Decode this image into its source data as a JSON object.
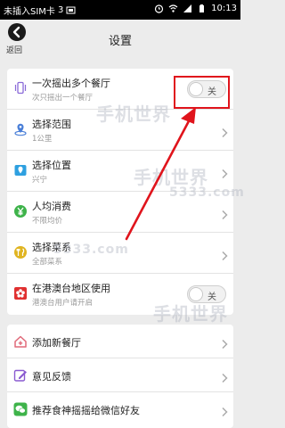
{
  "status_bar": {
    "carrier": "未插入SIM卡",
    "carrier2": "3",
    "time": "10:13"
  },
  "header": {
    "back_label": "返回",
    "title": "设置"
  },
  "settings_group_1": [
    {
      "id": "shake-multiple",
      "title": "一次摇出多个餐厅",
      "subtitle": "次只摇出一个餐厅",
      "control": "toggle",
      "toggle_label": "关",
      "icon": "phone-shake-icon",
      "icon_color": "#8a6ad8"
    },
    {
      "id": "select-range",
      "title": "选择范围",
      "subtitle": "1公里",
      "control": "chevron",
      "icon": "location-range-icon",
      "icon_color": "#4a7fd8"
    },
    {
      "id": "select-location",
      "title": "选择位置",
      "subtitle": "兴宁",
      "control": "chevron",
      "icon": "map-pin-icon",
      "icon_color": "#2ea0e0"
    },
    {
      "id": "avg-spend",
      "title": "人均消费",
      "subtitle": "不限均价",
      "control": "chevron",
      "icon": "yen-icon",
      "icon_color": "#3eb34a"
    },
    {
      "id": "select-cuisine",
      "title": "选择菜系",
      "subtitle": "全部菜系",
      "control": "chevron",
      "icon": "cuisine-icon",
      "icon_color": "#e0b420"
    },
    {
      "id": "hk-macau-tw",
      "title": "在港澳台地区使用",
      "subtitle": "港澳台用户请开启",
      "control": "toggle",
      "toggle_label": "关",
      "icon": "hk-flower-icon",
      "icon_color": "#e03030"
    }
  ],
  "settings_group_2": [
    {
      "id": "add-restaurant",
      "title": "添加新餐厅",
      "icon": "home-add-icon",
      "icon_color": "#e06a7a"
    },
    {
      "id": "feedback",
      "title": "意见反馈",
      "icon": "edit-icon",
      "icon_color": "#8a5ad0"
    },
    {
      "id": "recommend-wechat",
      "title": "推荐食神摇摇给微信好友",
      "icon": "wechat-icon",
      "icon_color": "#3eb34a"
    }
  ],
  "watermarks": [
    "手机世界",
    "5333.com",
    "手机世界",
    "5333.com",
    "手机世界"
  ],
  "annotation_color": "#e0141c"
}
